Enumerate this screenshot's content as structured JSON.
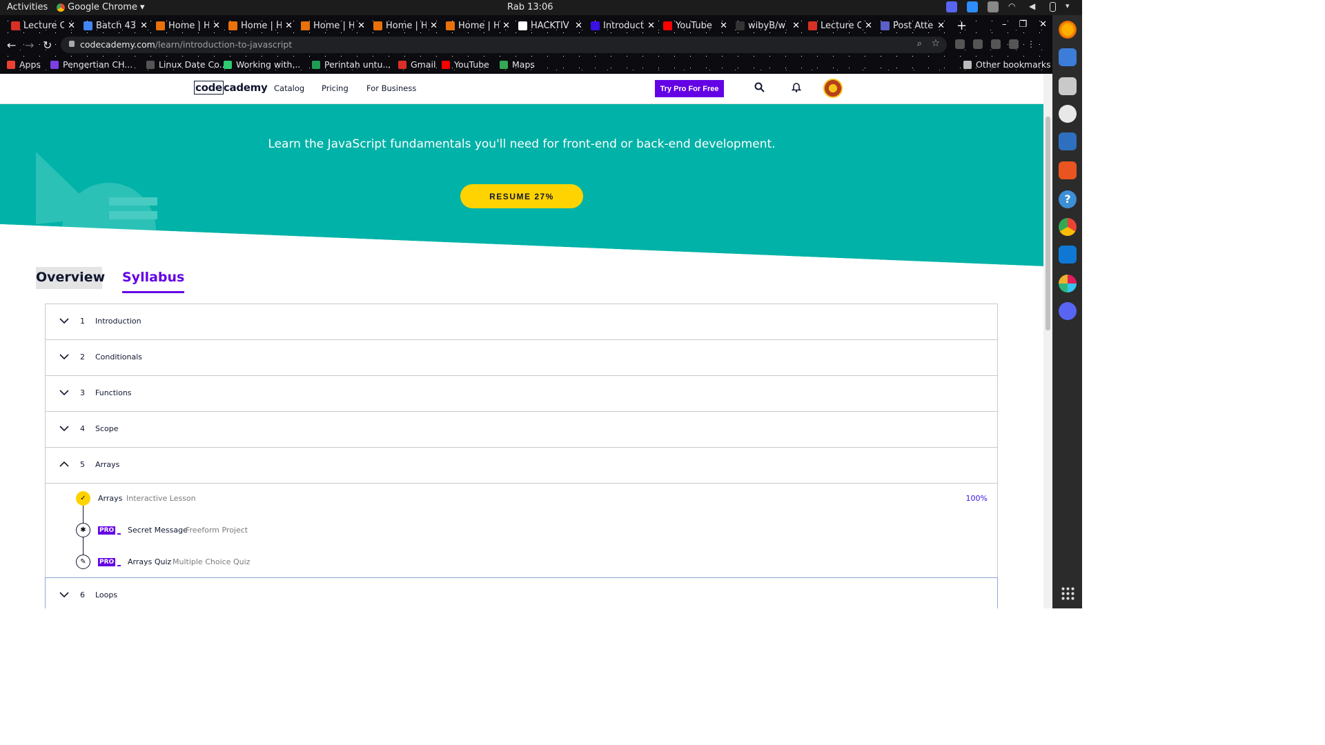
{
  "os": {
    "activities": "Activities",
    "app_name": "Google Chrome",
    "clock": "Rab 13:06"
  },
  "browser": {
    "tabs": [
      {
        "label": "Lecture C",
        "color": "#d93025"
      },
      {
        "label": "Batch 43",
        "color": "#4285f4"
      },
      {
        "label": "Home | H",
        "color": "#e8710a"
      },
      {
        "label": "Home | H",
        "color": "#e8710a"
      },
      {
        "label": "Home | H",
        "color": "#e8710a"
      },
      {
        "label": "Home | H",
        "color": "#e8710a"
      },
      {
        "label": "Home | H",
        "color": "#e8710a"
      },
      {
        "label": "HACKTIV",
        "color": "#ffffff"
      },
      {
        "label": "Introduct",
        "color": "#3a10e5"
      },
      {
        "label": "YouTube",
        "color": "#ff0000"
      },
      {
        "label": "wibyB/w",
        "color": "#333333"
      },
      {
        "label": "Lecture C",
        "color": "#d93025"
      },
      {
        "label": "Post Atte",
        "color": "#5b5fc7"
      }
    ],
    "url_host": "codecademy.com",
    "url_path": "/learn/introduction-to-javascript",
    "bookmarks": [
      {
        "label": "Apps",
        "color": "#e94235"
      },
      {
        "label": "Pengertian CH...",
        "color": "#7b3fe4"
      },
      {
        "label": "Linux Date Co...",
        "color": "#555555"
      },
      {
        "label": "Working with...",
        "color": "#2ecc71"
      },
      {
        "label": "Perintah untu...",
        "color": "#1f9d55"
      },
      {
        "label": "Gmail",
        "color": "#d93025"
      },
      {
        "label": "YouTube",
        "color": "#ff0000"
      },
      {
        "label": "Maps",
        "color": "#34a853"
      }
    ],
    "other_bookmarks": "Other bookmarks"
  },
  "header": {
    "logo_code": "code",
    "logo_rest": "cademy",
    "nav": [
      "Catalog",
      "Pricing",
      "For Business"
    ],
    "try_pro": "Try Pro For Free"
  },
  "hero": {
    "tagline": "Learn the JavaScript fundamentals you'll need for front-end or back-end development.",
    "resume": "RESUME 27%",
    "progress_percent": 27,
    "color": "#00b2a7"
  },
  "page_tabs": {
    "overview": "Overview",
    "syllabus": "Syllabus"
  },
  "syllabus": {
    "modules": [
      {
        "num": "1",
        "title": "Introduction"
      },
      {
        "num": "2",
        "title": "Conditionals"
      },
      {
        "num": "3",
        "title": "Functions"
      },
      {
        "num": "4",
        "title": "Scope"
      },
      {
        "num": "5",
        "title": "Arrays"
      },
      {
        "num": "6",
        "title": "Loops"
      }
    ],
    "lessons": [
      {
        "name": "Arrays",
        "type": "Interactive Lesson",
        "progress": "100%"
      },
      {
        "name": "Secret Message",
        "type": "Freeform Project",
        "badge": "PRO"
      },
      {
        "name": "Arrays Quiz",
        "type": "Multiple Choice Quiz",
        "badge": "PRO"
      }
    ]
  }
}
